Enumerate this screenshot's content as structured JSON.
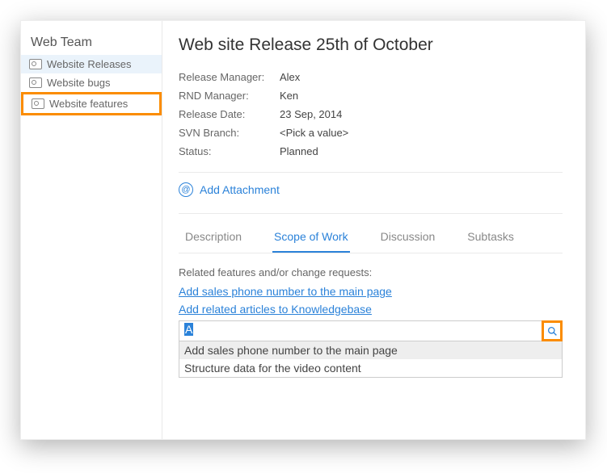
{
  "sidebar": {
    "title": "Web Team",
    "items": [
      {
        "label": "Website Releases"
      },
      {
        "label": "Website bugs"
      },
      {
        "label": "Website features"
      }
    ]
  },
  "page": {
    "title": "Web site Release 25th of October"
  },
  "fields": {
    "release_manager_label": "Release Manager:",
    "release_manager_value": "Alex",
    "rnd_manager_label": "RND Manager:",
    "rnd_manager_value": "Ken",
    "release_date_label": "Release Date:",
    "release_date_value": "23 Sep, 2014",
    "svn_branch_label": "SVN Branch:",
    "svn_branch_value": "<Pick a value>",
    "status_label": "Status:",
    "status_value": "Planned"
  },
  "attach": {
    "label": "Add Attachment"
  },
  "tabs": {
    "description": "Description",
    "scope": "Scope of Work",
    "discussion": "Discussion",
    "subtasks": "Subtasks"
  },
  "scope": {
    "related_label": "Related features and/or change requests:",
    "links": [
      "Add sales phone number to the main page",
      "Add related articles to Knowledgebase"
    ],
    "search_value": "A",
    "suggestions": [
      "Add sales phone number to the main page",
      "Structure data for the video content"
    ]
  }
}
